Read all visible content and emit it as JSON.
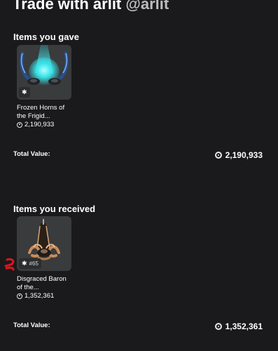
{
  "header": {
    "title": "Trade with arlit",
    "handle": "@arlit"
  },
  "gave": {
    "section_title": "Items you gave",
    "items": [
      {
        "name": "Frozen Horns of the Frigid...",
        "value": "2,190,933",
        "badge_icon": "limited-star-icon",
        "serial": ""
      }
    ],
    "total_label": "Total Value:",
    "total_value": "2,190,933"
  },
  "received": {
    "section_title": "Items you received",
    "items": [
      {
        "name": "Disgraced Baron of the...",
        "value": "1,352,361",
        "badge_icon": "limited-star-icon",
        "serial": "#65"
      }
    ],
    "total_label": "Total Value:",
    "total_value": "1,352,361"
  },
  "colors": {
    "background": "#1a1a1c",
    "thumbnail_bg": "#393b3d",
    "annotation": "#e0141e",
    "horns_glow": "#37e3e8"
  }
}
